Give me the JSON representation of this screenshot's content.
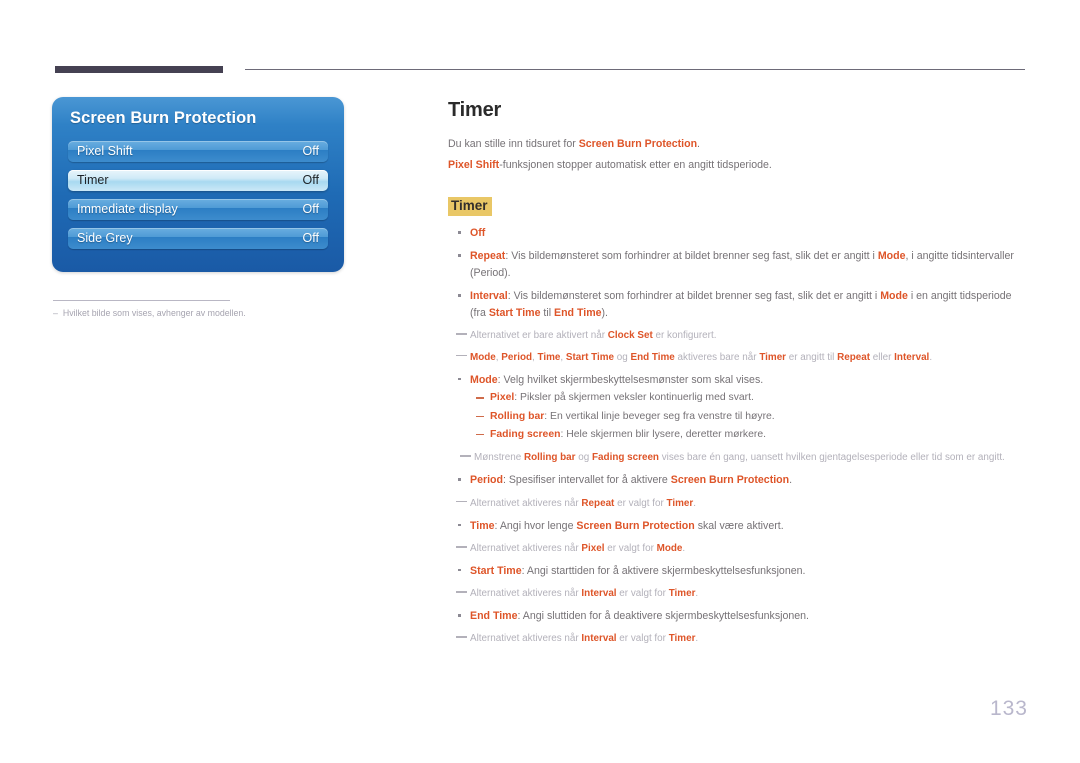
{
  "page": {
    "number": "133",
    "title": "Timer"
  },
  "osd": {
    "title": "Screen Burn Protection",
    "rows": [
      {
        "label": "Pixel Shift",
        "value": "Off",
        "selected": false
      },
      {
        "label": "Timer",
        "value": "Off",
        "selected": true
      },
      {
        "label": "Immediate display",
        "value": "Off",
        "selected": false
      },
      {
        "label": "Side Grey",
        "value": "Off",
        "selected": false
      }
    ],
    "footnote": {
      "marker": "–",
      "text": "Hvilket bilde som vises, avhenger av modellen."
    }
  },
  "content": {
    "intro_lines": [
      "Du kan stille inn tidsuret for Screen Burn Protection.",
      "Pixel Shift-funksjonen stopper automatisk etter en angitt tidsperiode."
    ],
    "sub_title": "Timer",
    "items": [
      {
        "term": "Off",
        "text": ""
      },
      {
        "term": "Repeat",
        "text": ": Vis bildemønsteret som forhindrer at bildet brenner seg fast, slik det er angitt i Mode, i angitte tidsintervaller (Period)."
      },
      {
        "term": "Interval",
        "text": ": Vis bildemønsteret som forhindrer at bildet brenner seg fast, slik det er angitt i Mode i en angitt tidsperiode (fra Start Time til End Time)."
      },
      {
        "term": "Mode",
        "text": ": Velg hvilket skjermbeskyttelsesmønster som skal vises."
      },
      {
        "term": "Period",
        "text": ": Spesifiser intervallet for å aktivere Screen Burn Protection."
      },
      {
        "term": "Time",
        "text": ": Angi hvor lenge Screen Burn Protection skal være aktivert."
      },
      {
        "term": "Start Time",
        "text": ": Angi starttiden for å aktivere skjermbeskyttelsesfunksjonen."
      },
      {
        "term": "End Time",
        "text": ": Angi sluttiden for å deaktivere skjermbeskyttelsesfunksjonen."
      }
    ],
    "mode_options": [
      {
        "term": "Pixel",
        "text": ": Piksler på skjermen veksler kontinuerlig med svart."
      },
      {
        "term": "Rolling bar",
        "text": ": En vertikal linje beveger seg fra venstre til høyre."
      },
      {
        "term": "Fading screen",
        "text": ": Hele skjermen blir lysere, deretter mørkere."
      }
    ],
    "notes": {
      "clock_set": "Alternativet er bare aktivert når Clock Set er konfigurert.",
      "mode_period": "Mode, Period, Time, Start Time og End Time aktiveres bare når Timer er angitt til Repeat eller Interval.",
      "patterns": "Mønstrene Rolling bar og Fading screen vises bare én gang, uansett hvilken gjentagelsesperiode eller tid som er angitt.",
      "period_note": "Alternativet aktiveres når Repeat er valgt for Timer.",
      "time_note": "Alternativet aktiveres når Pixel er valgt for Mode.",
      "start_time_note": "Alternativet aktiveres når Interval er valgt for Timer.",
      "end_time_note": "Alternativet aktiveres når Interval er valgt for Timer."
    }
  },
  "colors": {
    "term": "#de5529",
    "highlight": "#e9c766",
    "panel_blue": "#1f6bb5",
    "rule_dark": "#454152",
    "page_number": "#b9b7cc",
    "body_text": "#767276",
    "note_text": "#b3b1ba"
  }
}
